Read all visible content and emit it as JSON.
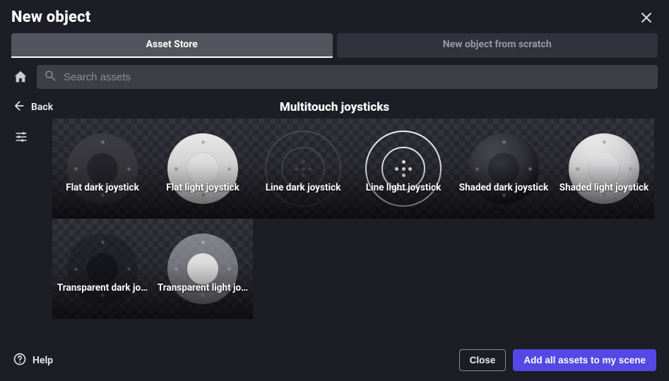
{
  "dialog": {
    "title": "New object"
  },
  "tabs": {
    "active": 0,
    "items": [
      "Asset Store",
      "New object from scratch"
    ]
  },
  "search": {
    "placeholder": "Search assets",
    "value": ""
  },
  "back_label": "Back",
  "category_title": "Multitouch joysticks",
  "assets": [
    {
      "label": "Flat dark joystick",
      "variant": "flat-dark"
    },
    {
      "label": "Flat light joystick",
      "variant": "flat-light"
    },
    {
      "label": "Line dark joystick",
      "variant": "line-dark"
    },
    {
      "label": "Line light joystick",
      "variant": "line-light"
    },
    {
      "label": "Shaded dark joystick",
      "variant": "shaded-dark"
    },
    {
      "label": "Shaded light joystick",
      "variant": "shaded-light"
    },
    {
      "label": "Transparent dark jo…",
      "variant": "trans-dark"
    },
    {
      "label": "Transparent light jo…",
      "variant": "trans-light"
    }
  ],
  "footer": {
    "help": "Help",
    "close": "Close",
    "add_all": "Add all assets to my scene"
  },
  "colors": {
    "bg": "#1d1d26",
    "accent": "#5548e6"
  }
}
